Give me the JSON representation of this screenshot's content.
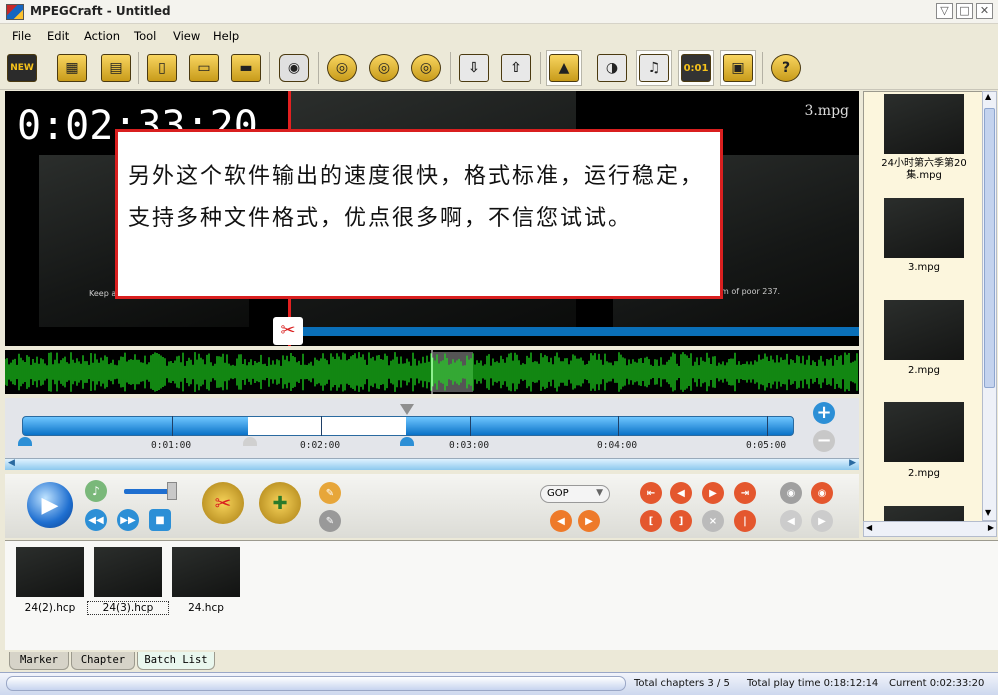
{
  "window": {
    "title": "MPEGCraft - Untitled"
  },
  "menu": {
    "items": [
      "File",
      "Edit",
      "Action",
      "Tool",
      "View",
      "Help"
    ]
  },
  "toolbar": {
    "new_label": "NEW",
    "timecode_label": "0:01"
  },
  "preview": {
    "timecode": "0:02:33:20",
    "clip_name": "3.mpg",
    "caption": "另外这个软件输出的速度很快，格式标准，运行稳定，支持多种文件格式，优点很多啊，不信您试试。",
    "subtitle_left": "Keep a",
    "subtitle_right": "m of poor 237."
  },
  "timeline": {
    "ticks": [
      "0:01:00",
      "0:02:00",
      "0:03:00",
      "0:04:00",
      "0:05:00"
    ],
    "zoom_in": "+",
    "zoom_out": "−"
  },
  "controls": {
    "mode_select": "GOP"
  },
  "clips": [
    {
      "label": "24小时第六季第20集.mpg"
    },
    {
      "label": "3.mpg"
    },
    {
      "label": "2.mpg"
    },
    {
      "label": "2.mpg"
    }
  ],
  "batch": [
    {
      "label": "24(2).hcp"
    },
    {
      "label": "24(3).hcp"
    },
    {
      "label": "24.hcp"
    }
  ],
  "tabs": [
    "Marker",
    "Chapter",
    "Batch List"
  ],
  "status": {
    "chapters": "Total chapters 3 / 5",
    "play_time": "Total play time 0:18:12:14",
    "current": "Current 0:02:33:20"
  },
  "colors": {
    "playhead": "#e32020",
    "waveform": "#1ee01e",
    "track": "#0a72c7",
    "caption_border": "#d91f1f"
  }
}
